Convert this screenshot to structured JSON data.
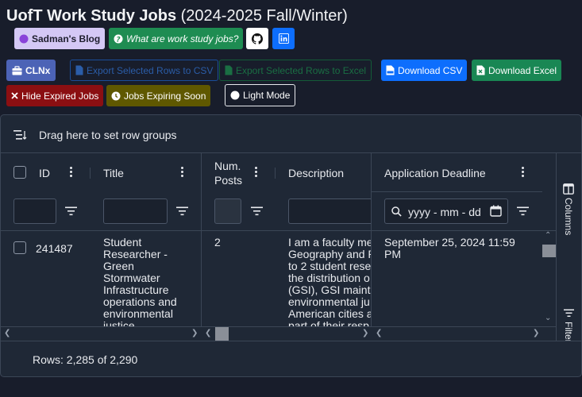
{
  "header": {
    "title_bold": "UofT Work Study Jobs",
    "title_rest": " (2024-2025 Fall/Winter)"
  },
  "links": {
    "blog": "Sadman's Blog",
    "faq": "What are work study jobs?"
  },
  "toolbar": {
    "clnx": "CLNx",
    "export_csv": "Export Selected Rows to CSV",
    "export_excel": "Export Selected Rows to Excel",
    "download_csv": "Download CSV",
    "download_excel": "Download Excel",
    "hide_expired": "Hide Expired Jobs",
    "expiring_soon": "Jobs Expiring Soon",
    "light_mode": "Light Mode"
  },
  "grid": {
    "group_panel": "Drag here to set row groups",
    "columns": {
      "id": "ID",
      "title": "Title",
      "num_posts_line1": "Num.",
      "num_posts_line2": "Posts",
      "description": "Description",
      "deadline": "Application Deadline"
    },
    "date_placeholder": "yyyy - mm - dd",
    "side_panel": {
      "columns": "Columns",
      "filters": "Filters"
    },
    "rows": [
      {
        "id": "241487",
        "title_lines": [
          "Student",
          "Researcher -",
          "Green",
          "Stormwater",
          "Infrastructure",
          "operations and",
          "environmental",
          "justice"
        ],
        "num_posts": "2",
        "description_lines": [
          "I am a faculty me",
          "Geography and P",
          "to 2 student rese",
          "the distribution o",
          "(GSI), GSI mainte",
          "environmental ju",
          "American cities as",
          "part of their resp"
        ],
        "deadline_line1": "September 25, 2024 11:59",
        "deadline_line2": "PM"
      }
    ],
    "status": "Rows: 2,285 of 2,290"
  },
  "colors": {
    "background": "#181d2b",
    "panel": "#1f2836",
    "blog_badge": "#d4c8f5",
    "faq_badge": "#1e8c52",
    "primary": "#0d6efd",
    "success": "#198754",
    "danger": "#8b0f12",
    "warning": "#5f5800"
  }
}
